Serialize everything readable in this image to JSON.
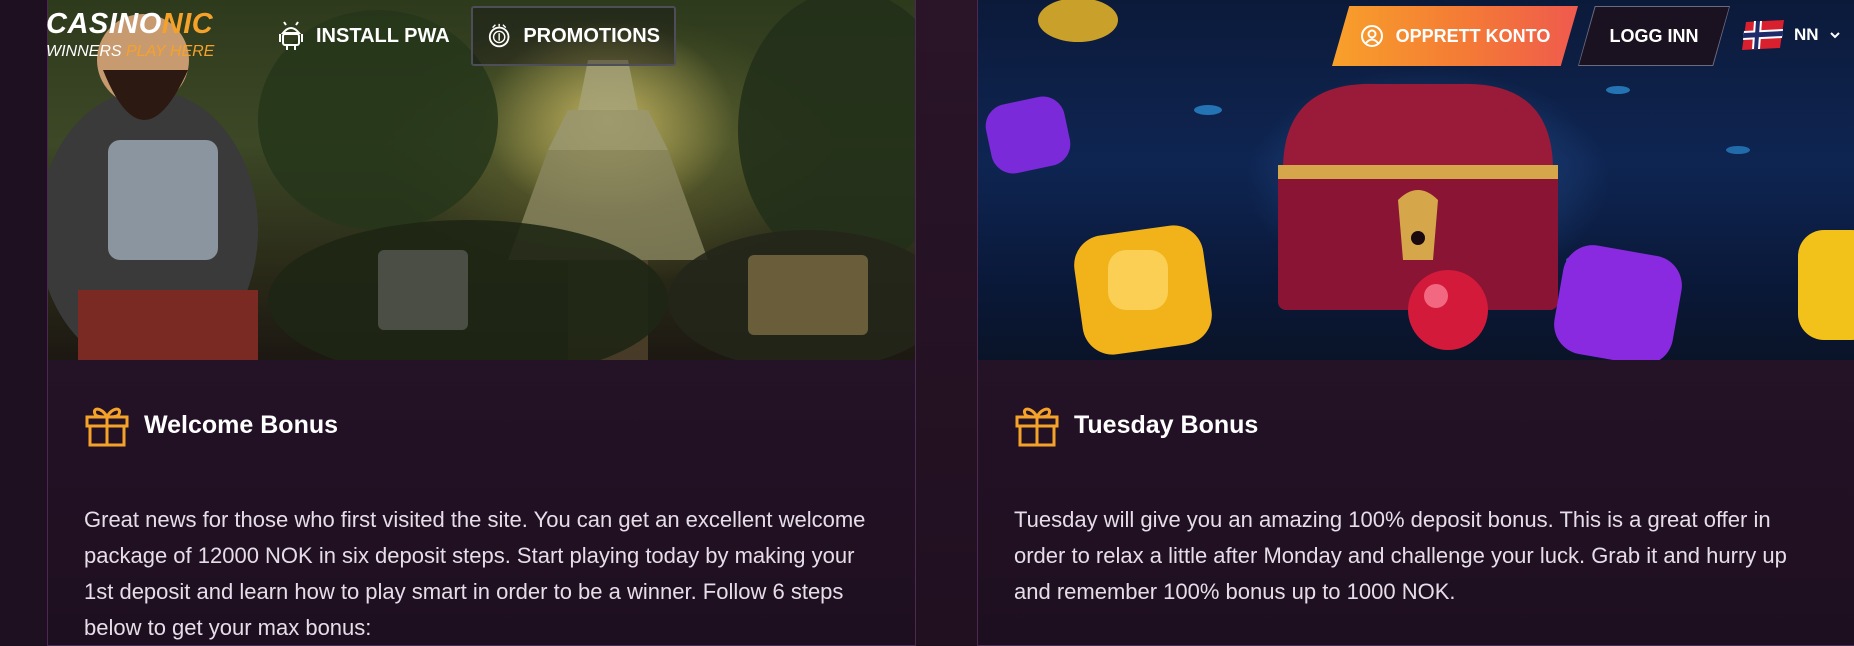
{
  "header": {
    "logo": {
      "main_a": "CASINO",
      "main_b": "NIC",
      "tagline_a": "WINNERS ",
      "tagline_b": "PLAY HERE"
    },
    "nav": [
      {
        "label": "INSTALL PWA",
        "icon": "android-icon"
      },
      {
        "label": "PROMOTIONS",
        "icon": "coins-icon"
      }
    ],
    "register_label": "OPPRETT KONTO",
    "login_label": "LOGG INN",
    "language": {
      "code": "NN",
      "flag": "norway-flag"
    }
  },
  "colors": {
    "accent": "#f5a22a",
    "background": "#1e1020",
    "card": "#2a1530"
  },
  "promotions": [
    {
      "title": "Welcome Bonus",
      "icon": "gift-icon",
      "text": "Great news for those who first visited the site. You can get an excellent welcome package of 12000 NOK in six deposit steps. Start playing today by making your 1st deposit and learn how to play smart in order to be a winner. Follow 6 steps below to get your max bonus:"
    },
    {
      "title": "Tuesday Bonus",
      "icon": "gift-icon",
      "text": "Tuesday will give you an amazing 100% deposit bonus. This is a great offer in order to relax a little after Monday and challenge your luck. Grab it and hurry up and remember 100% bonus up to 1000 NOK."
    }
  ]
}
